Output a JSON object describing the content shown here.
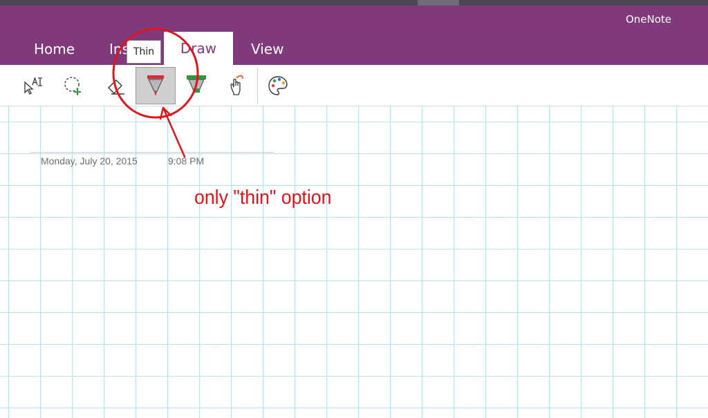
{
  "app": {
    "title": "OneNote"
  },
  "tabs": [
    {
      "label": "Home"
    },
    {
      "label": "Ins"
    },
    {
      "label": "Draw"
    },
    {
      "label": "View"
    }
  ],
  "ribbon": {
    "tools": [
      {
        "icon": "text-select-icon"
      },
      {
        "icon": "lasso-select-icon"
      },
      {
        "icon": "eraser-icon"
      },
      {
        "icon": "thin-pen-icon",
        "selected": true
      },
      {
        "icon": "highlighter-icon"
      },
      {
        "icon": "touch-draw-icon"
      },
      {
        "icon": "color-palette-icon"
      }
    ],
    "tooltip": "Thin"
  },
  "page": {
    "date": "Monday, July 20, 2015",
    "time": "9:08 PM"
  },
  "annotation": {
    "text": "only \"thin\" option",
    "color": "#e0141b"
  },
  "colors": {
    "header": "#80397b",
    "grid": "#b8e2f2"
  }
}
